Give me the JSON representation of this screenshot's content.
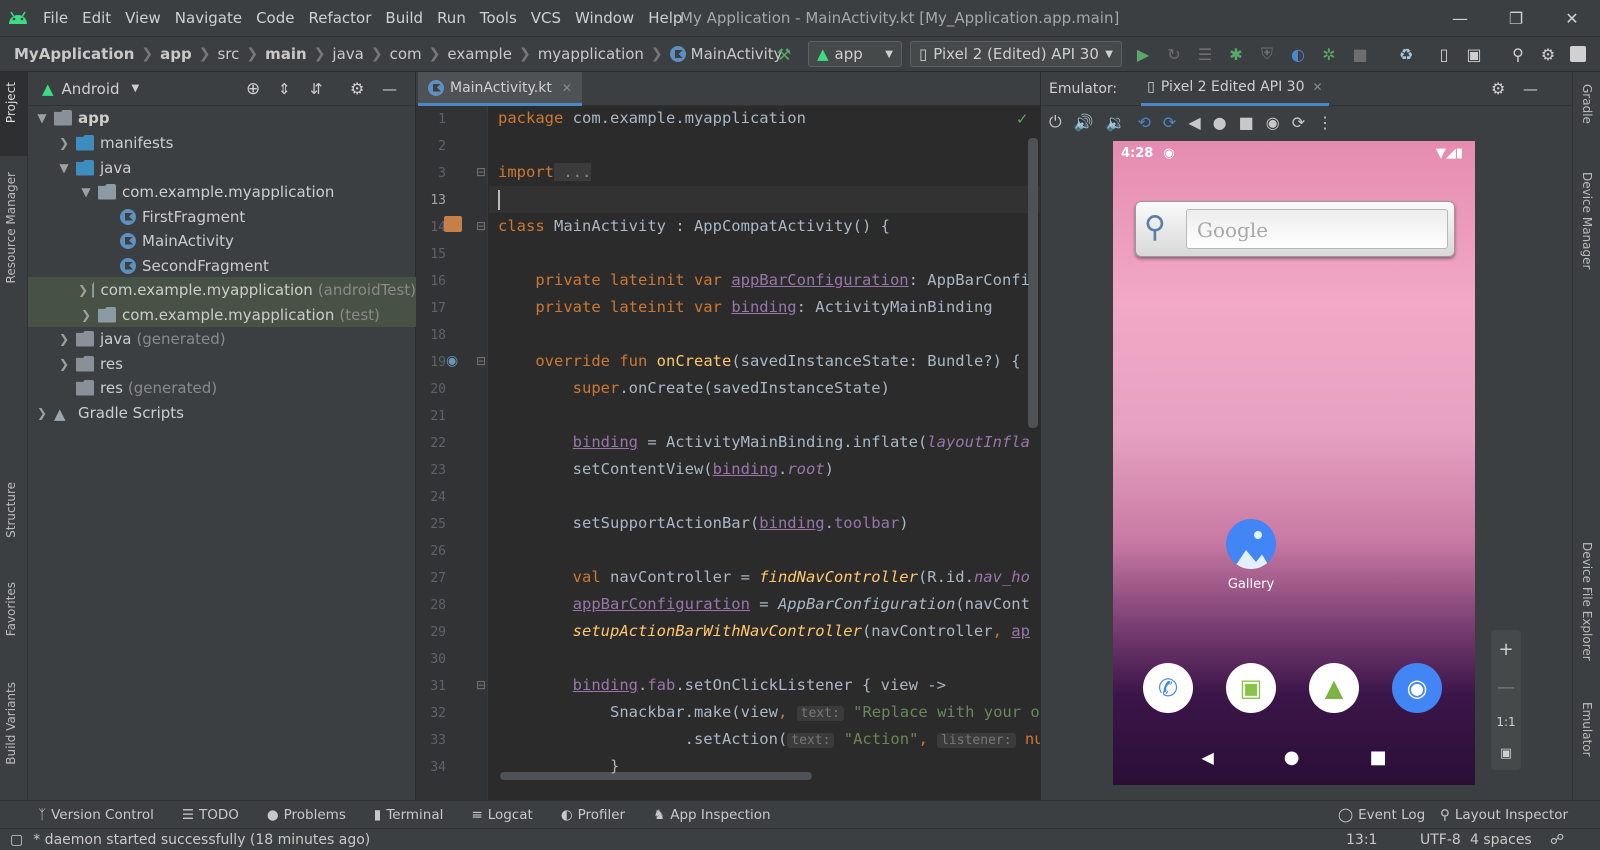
{
  "menu": [
    "File",
    "Edit",
    "View",
    "Navigate",
    "Code",
    "Refactor",
    "Build",
    "Run",
    "Tools",
    "VCS",
    "Window",
    "Help"
  ],
  "window_title": "My Application - MainActivity.kt [My_Application.app.main]",
  "breadcrumbs": [
    "MyApplication",
    "app",
    "src",
    "main",
    "java",
    "com",
    "example",
    "myapplication",
    "MainActivity"
  ],
  "run_config": "app",
  "device": "Pixel 2 (Edited) API 30",
  "project_panel": {
    "view_mode": "Android",
    "tree": [
      {
        "label": "app",
        "dim": ""
      },
      {
        "label": "manifests",
        "dim": ""
      },
      {
        "label": "java",
        "dim": ""
      },
      {
        "label": "com.example.myapplication",
        "dim": ""
      },
      {
        "label": "FirstFragment",
        "dim": ""
      },
      {
        "label": "MainActivity",
        "dim": ""
      },
      {
        "label": "SecondFragment",
        "dim": ""
      },
      {
        "label": "com.example.myapplication",
        "dim": "(androidTest)"
      },
      {
        "label": "com.example.myapplication",
        "dim": "(test)"
      },
      {
        "label": "java",
        "dim": "(generated)"
      },
      {
        "label": "res",
        "dim": ""
      },
      {
        "label": "res",
        "dim": "(generated)"
      },
      {
        "label": "Gradle Scripts",
        "dim": ""
      }
    ]
  },
  "left_strip": [
    "Project",
    "Resource Manager",
    "Structure",
    "Favorites",
    "Build Variants"
  ],
  "right_strip": [
    "Gradle",
    "Device Manager",
    "Device File Explorer",
    "Emulator"
  ],
  "editor": {
    "tab": "MainActivity.kt",
    "line_numbers": [
      "1",
      "2",
      "3",
      "13",
      "14",
      "15",
      "16",
      "17",
      "18",
      "19",
      "20",
      "21",
      "22",
      "23",
      "24",
      "25",
      "26",
      "27",
      "28",
      "29",
      "30",
      "31",
      "32",
      "33",
      "34"
    ],
    "code": {
      "l1a": "package",
      "l1b": " com.example.myapplication",
      "l3a": "import",
      "l3b": " ...",
      "l14a": "class",
      "l14b": " MainActivity : AppCompatActivity() {",
      "l16a": "    private lateinit var",
      "l16b": " ",
      "l16c": "appBarConfiguration",
      "l16d": ": AppBarConfi",
      "l17a": "    private lateinit var",
      "l17b": " ",
      "l17c": "binding",
      "l17d": ": ActivityMainBinding",
      "l19a": "    override fun",
      "l19b": " ",
      "l19c": "onCreate",
      "l19d": "(savedInstanceState: Bundle?) {",
      "l20a": "        super",
      "l20b": ".onCreate(savedInstanceState)",
      "l22a": "        ",
      "l22b": "binding",
      "l22c": " = ActivityMainBinding.inflate(",
      "l22d": "layoutInfla",
      "l23a": "        setContentView(",
      "l23b": "binding",
      "l23c": ".",
      "l23d": "root",
      "l23e": ")",
      "l25a": "        setSupportActionBar(",
      "l25b": "binding",
      "l25c": ".",
      "l25d": "toolbar",
      "l25e": ")",
      "l27a": "        val",
      "l27b": " navController = ",
      "l27c": "findNavController",
      "l27d": "(R.id.",
      "l27e": "nav_ho",
      "l28a": "        ",
      "l28b": "appBarConfiguration",
      "l28c": " = ",
      "l28d": "AppBarConfiguration",
      "l28e": "(navCont",
      "l29a": "        ",
      "l29b": "setupActionBarWithNavController",
      "l29c": "(navController",
      "l29d": ", ",
      "l29e": "ap",
      "l31a": "        ",
      "l31b": "binding",
      "l31c": ".",
      "l31d": "fab",
      "l31e": ".setOnClickListener { view ->",
      "l32a": "            Snackbar.make(view",
      "l32b": ", ",
      "l32c": "text:",
      "l32d": " \"Replace with your o",
      "l33a": "                    .setAction(",
      "l33b": "text:",
      "l33c": " \"Action\"",
      "l33d": ", ",
      "l33e": "listener:",
      "l33f": " null",
      "l34a": "            }"
    }
  },
  "emulator": {
    "label": "Emulator:",
    "tab": "Pixel 2 Edited API 30",
    "clock": "4:28",
    "search_hint": "Google",
    "app_label": "Gallery",
    "zoom_ratio": "1:1"
  },
  "bottom_tools": [
    "Version Control",
    "TODO",
    "Problems",
    "Terminal",
    "Logcat",
    "Profiler",
    "App Inspection"
  ],
  "bottom_right_tools": [
    "Event Log",
    "Layout Inspector"
  ],
  "status": {
    "message": "* daemon started successfully (18 minutes ago)",
    "position": "13:1",
    "encoding": "UTF-8",
    "indent": "4 spaces"
  },
  "colors": {
    "accent": "#4a88c7",
    "android_green": "#3ddc84",
    "run_green": "#59a869"
  }
}
